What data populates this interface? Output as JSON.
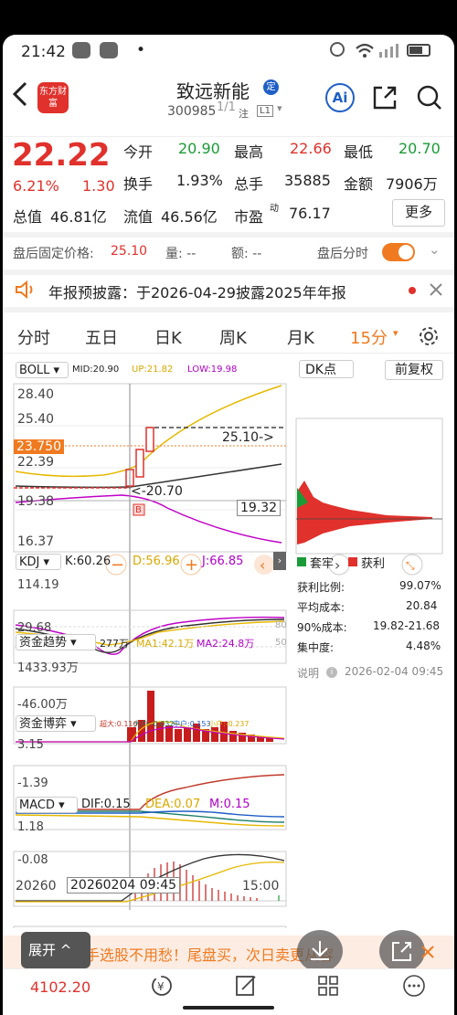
{
  "status": {
    "time": "21:42",
    "dot": "•"
  },
  "header": {
    "title": "致远新能",
    "badge": "定",
    "code": "300985",
    "watermark": "1/1",
    "tag_follow": "注",
    "tag_level": "L1",
    "logo_text": "东方财富",
    "ai_label": "Ai"
  },
  "quote": {
    "price": "22.22",
    "change_pct": "6.21%",
    "change": "1.30",
    "open_label": "今开",
    "open": "20.90",
    "high_label": "最高",
    "high": "22.66",
    "low_label": "最低",
    "low": "20.70",
    "turnover_label": "换手",
    "turnover": "1.93%",
    "volume_label": "总手",
    "volume": "35885",
    "amount_label": "金额",
    "amount": "7906万",
    "mktcap_label": "总值",
    "mktcap": "46.81亿",
    "float_label": "流值",
    "float": "46.56亿",
    "pe_label": "市盈",
    "pe_sup": "动",
    "pe": "76.17",
    "more_label": "更多"
  },
  "afterhours": {
    "fixed_label": "盘后固定价格:",
    "fixed_value": "25.10",
    "vol_label": "量: --",
    "amt_label": "额: --",
    "timeshare_label": "盘后分时"
  },
  "notice": {
    "text": "年报预披露：于2026-04-29披露2025年年报"
  },
  "tabs": [
    "分时",
    "五日",
    "日K",
    "周K",
    "月K",
    "15分"
  ],
  "boll": {
    "name": "BOLL",
    "mid": "MID:20.90",
    "up": "UP:21.82",
    "low": "LOW:19.98",
    "y1": "28.40",
    "y2": "25.40",
    "y3": "22.39",
    "y4": "19.38",
    "y5": "16.37",
    "cur": "23.750",
    "mark_high": "25.10->",
    "mark_low": "<-20.70",
    "cursor_val": "19.32",
    "b_marker": "B"
  },
  "dk": {
    "label": "DK点",
    "fq": "前复权",
    "legend_trap": "套牢",
    "legend_profit": "获利",
    "rows": [
      {
        "k": "获利比例:",
        "v": "99.07%"
      },
      {
        "k": "平均成本:",
        "v": "20.84"
      },
      {
        "k": "90%成本:",
        "v": "19.82-21.68"
      },
      {
        "k": "集中度:",
        "v": "4.48%"
      }
    ],
    "note_label": "说明",
    "note_time": "2026-02-04 09:45"
  },
  "kdj": {
    "name": "KDJ",
    "k": "K:60.26",
    "d": "D:56.96",
    "j": "J:66.85",
    "y1": "114.19",
    "y2": "29.68",
    "r80": "80",
    "r50": "50"
  },
  "fund": {
    "name": "资金趋势",
    "v": "277万",
    "ma1": "MA1:42.1万",
    "ma2": "MA2:24.8万",
    "y1": "1433.93万",
    "y2": "-46.00万"
  },
  "game": {
    "name": "资金博弈",
    "super": "超大:0.116",
    "big": "大户:-0.032",
    "mid": "中户:0.153",
    "small": "小户:-0.237",
    "y1": "3.15",
    "y2": "-1.39"
  },
  "macd": {
    "name": "MACD",
    "dif": "DIF:0.15",
    "dea": "DEA:0.07",
    "m": "M:0.15",
    "y1": "1.18",
    "y2": "-0.08"
  },
  "timeaxis": {
    "start": "20260",
    "cursor": "20260204 09:45",
    "end": "15:00"
  },
  "banner": {
    "expand": "展开",
    "text": "手选股不用愁！尾盘买，次日卖更从容"
  },
  "bottom": {
    "index": "4102.20"
  },
  "colors": {
    "up": "#e0312c",
    "down": "#1a9b37",
    "accent": "#f07a20",
    "blue": "#1f5fc6"
  }
}
